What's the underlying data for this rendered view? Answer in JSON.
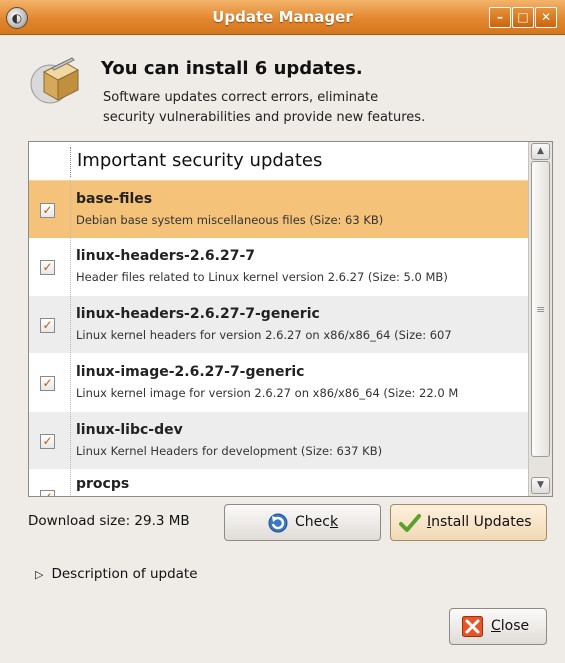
{
  "window": {
    "title": "Update Manager",
    "controls": [
      "minimize",
      "maximize",
      "close"
    ]
  },
  "header": {
    "heading": "You can install 6 updates.",
    "subtext": "Software updates correct errors, eliminate\nsecurity vulnerabilities and provide new features."
  },
  "updates_list": {
    "group_title": "Important security updates",
    "items": [
      {
        "name": "base-files",
        "description": "Debian base system miscellaneous files (Size: 63 KB)",
        "checked": true,
        "selected": true
      },
      {
        "name": "linux-headers-2.6.27-7",
        "description": "Header files related to Linux kernel version 2.6.27 (Size: 5.0 MB)",
        "checked": true,
        "selected": false
      },
      {
        "name": "linux-headers-2.6.27-7-generic",
        "description": "Linux kernel headers for version 2.6.27 on x86/x86_64 (Size: 607",
        "checked": true,
        "selected": false
      },
      {
        "name": "linux-image-2.6.27-7-generic",
        "description": "Linux kernel image for version 2.6.27 on x86/x86_64 (Size: 22.0 M",
        "checked": true,
        "selected": false
      },
      {
        "name": "linux-libc-dev",
        "description": "Linux Kernel Headers for development (Size: 637 KB)",
        "checked": true,
        "selected": false
      },
      {
        "name": "procps",
        "description": "",
        "checked": true,
        "selected": false
      }
    ]
  },
  "footer": {
    "download_size": "Download size: 29.3 MB",
    "check_pre": "Chec",
    "check_mnemonic": "k",
    "install_mnemonic": "I",
    "install_rest": "nstall Updates",
    "description_toggle": "Description of update",
    "close_mnemonic": "C",
    "close_rest": "lose"
  },
  "colors": {
    "titlebar": "#e2872f",
    "selected_row": "#f5c27a",
    "window_bg": "#efebe7",
    "check_mark": "#c2580a"
  },
  "icons": {
    "app": "update-manager-icon",
    "header": "package-box-icon",
    "check": "refresh-icon",
    "install": "checkmark-icon",
    "close": "close-x-icon"
  }
}
